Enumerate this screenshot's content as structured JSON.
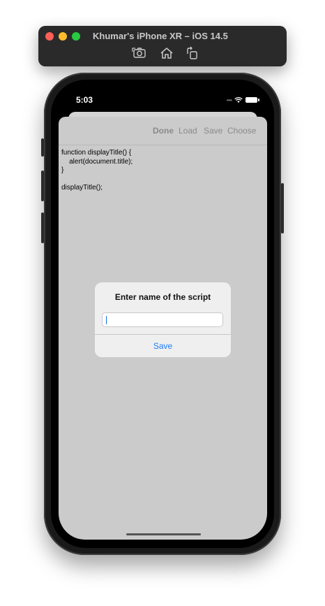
{
  "window": {
    "title": "Khumar's iPhone XR – iOS 14.5",
    "toolbar": {
      "screenshot_icon": "camera-icon",
      "home_icon": "home-icon",
      "rotate_icon": "rotate-icon"
    }
  },
  "status_bar": {
    "time": "5:03",
    "cell_signal": "••••"
  },
  "nav": {
    "done_label": "Done",
    "load_label": "Load",
    "save_label": "Save",
    "choose_label": "Choose"
  },
  "editor": {
    "code": "function displayTitle() {\n    alert(document.title);\n}\n\ndisplayTitle();"
  },
  "alert": {
    "title": "Enter name of the script",
    "input_value": "",
    "input_placeholder": "",
    "save_label": "Save"
  },
  "colors": {
    "accent": "#1a7cf5",
    "sheet_background": "#cbcbcb",
    "traffic_close": "#fe5f57",
    "traffic_minimize": "#febc2e",
    "traffic_maximize": "#28c840"
  }
}
